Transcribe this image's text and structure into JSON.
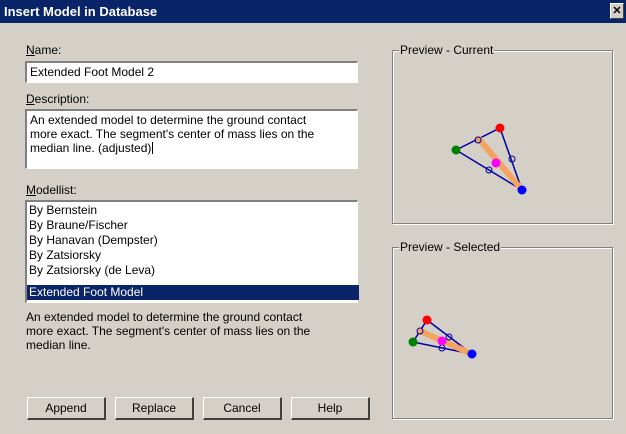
{
  "window": {
    "title": "Insert Model in Database",
    "close_glyph": "✕"
  },
  "name": {
    "label_mnemonic": "N",
    "label_rest": "ame:",
    "value": "Extended Foot Model 2"
  },
  "description": {
    "label_mnemonic": "D",
    "label_rest": "escription:",
    "lines": [
      "An extended model to determine the ground contact",
      "more exact. The segment's center of mass lies on the",
      "median line. (adjusted)"
    ]
  },
  "modellist": {
    "label_mnemonic": "M",
    "label_rest": "odellist:",
    "items": [
      "By Bernstein",
      "By Braune/Fischer",
      "By Hanavan (Dempster)",
      "By Zatsiorsky",
      "By Zatsiorsky (de Leva)",
      "Extended Foot Model"
    ],
    "selected_index": 5
  },
  "selected_description": {
    "lines": [
      "An extended model to determine the ground contact",
      "more exact. The segment's center of mass lies on the",
      "median line."
    ]
  },
  "buttons": {
    "append": "Append",
    "replace": "Replace",
    "cancel": "Cancel",
    "help": "Help"
  },
  "preview_current": {
    "label": "Preview - Current"
  },
  "preview_selected": {
    "label": "Preview - Selected"
  },
  "colors": {
    "title_bar": "#0a246a",
    "selection": "#0a246a",
    "segment_line": "#0000a0",
    "median_line": "#f4a460",
    "point_red": "#ff0000",
    "point_green": "#008000",
    "point_magenta": "#ff00ff",
    "point_blue": "#0000ff"
  }
}
